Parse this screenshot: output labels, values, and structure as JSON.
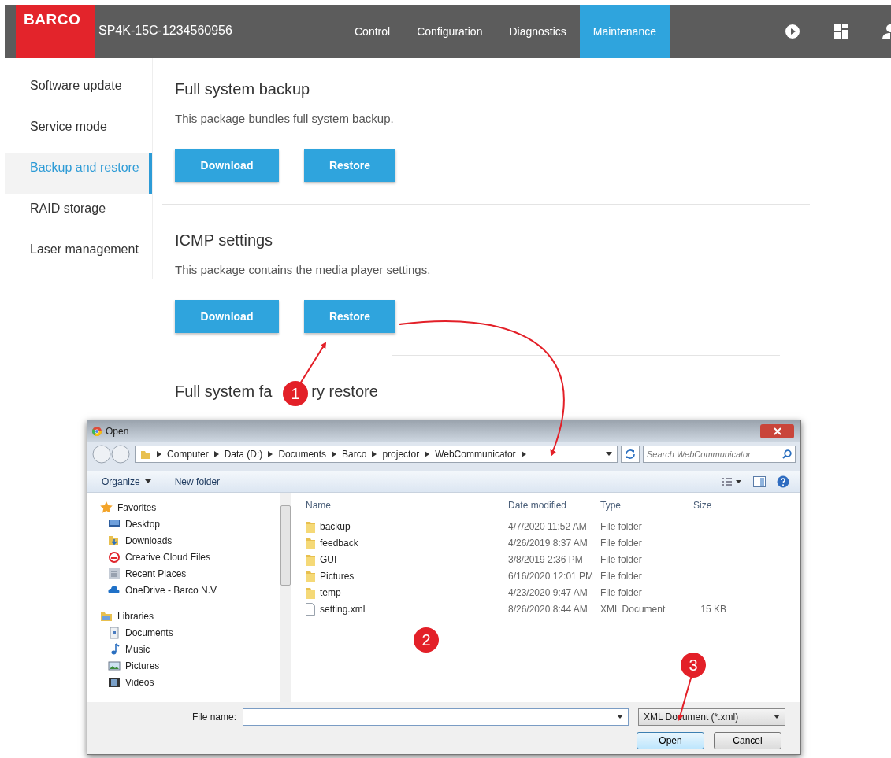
{
  "app": {
    "logo": "BARCO",
    "device": "SP4K-15C-1234560956",
    "tabs": [
      {
        "label": "Control",
        "selected": false
      },
      {
        "label": "Configuration",
        "selected": false
      },
      {
        "label": "Diagnostics",
        "selected": false
      },
      {
        "label": "Maintenance",
        "selected": true
      }
    ],
    "sidebar": {
      "items": [
        {
          "label": "Software update",
          "selected": false
        },
        {
          "label": "Service mode",
          "selected": false
        },
        {
          "label": "Backup and restore",
          "selected": true
        },
        {
          "label": "RAID storage",
          "selected": false
        },
        {
          "label": "Laser management",
          "selected": false
        }
      ]
    },
    "sections": [
      {
        "title": "Full system backup",
        "description": "This package bundles full system backup.",
        "buttons": [
          "Download",
          "Restore"
        ]
      },
      {
        "title": "ICMP settings",
        "description": "This package contains the media player settings.",
        "buttons": [
          "Download",
          "Restore"
        ]
      },
      {
        "title_parts": [
          "Full system fa",
          "ry restore"
        ]
      }
    ]
  },
  "dialog": {
    "title": "Open",
    "breadcrumb": [
      "Computer",
      "Data (D:)",
      "Documents",
      "Barco",
      "projector",
      "WebCommunicator"
    ],
    "search": {
      "placeholder": "Search WebCommunicator"
    },
    "toolbar": {
      "organize": "Organize",
      "new_folder": "New folder"
    },
    "nav": [
      {
        "label": "Favorites",
        "children": [
          {
            "label": "Desktop"
          },
          {
            "label": "Downloads"
          },
          {
            "label": "Creative Cloud Files"
          },
          {
            "label": "Recent Places"
          },
          {
            "label": "OneDrive - Barco N.V"
          }
        ]
      },
      {
        "label": "Libraries",
        "children": [
          {
            "label": "Documents"
          },
          {
            "label": "Music"
          },
          {
            "label": "Pictures"
          },
          {
            "label": "Videos"
          }
        ]
      }
    ],
    "columns": [
      "Name",
      "Date modified",
      "Type",
      "Size"
    ],
    "rows": [
      {
        "kind": "folder",
        "name": "backup",
        "date": "4/7/2020 11:52 AM",
        "type": "File folder"
      },
      {
        "kind": "folder",
        "name": "feedback",
        "date": "4/26/2019 8:37 AM",
        "type": "File folder"
      },
      {
        "kind": "folder",
        "name": "GUI",
        "date": "3/8/2019 2:36 PM",
        "type": "File folder"
      },
      {
        "kind": "folder",
        "name": "Pictures",
        "date": "6/16/2020 12:01 PM",
        "type": "File folder"
      },
      {
        "kind": "folder",
        "name": "temp",
        "date": "4/23/2020 9:47 AM",
        "type": "File folder"
      },
      {
        "kind": "file",
        "name": "setting.xml",
        "date": "8/26/2020 8:44 AM",
        "type": "XML Document",
        "size": "15 KB"
      }
    ],
    "file_name_label": "File name:",
    "filter": "XML Document (*.xml)",
    "buttons": [
      {
        "label": "Open",
        "default": true
      },
      {
        "label": "Cancel",
        "default": false
      }
    ]
  },
  "callouts": [
    "1",
    "2",
    "3"
  ]
}
